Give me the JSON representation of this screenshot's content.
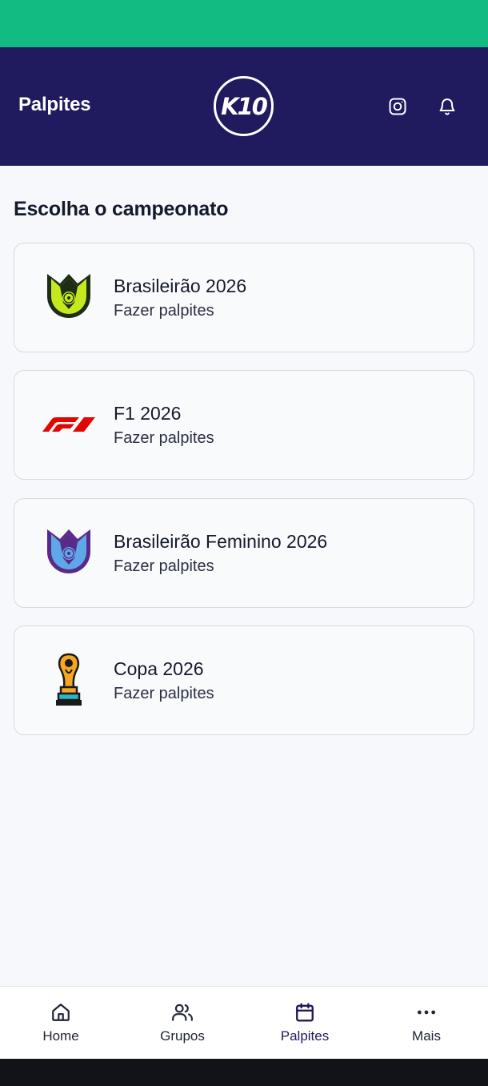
{
  "header": {
    "title": "Palpites",
    "logo_text": "K10"
  },
  "main": {
    "section_title": "Escolha o campeonato",
    "championships": [
      {
        "name": "Brasileirão 2026",
        "action": "Fazer palpites",
        "icon": "brasileirao-emblem-icon"
      },
      {
        "name": "F1 2026",
        "action": "Fazer palpites",
        "icon": "f1-logo-icon"
      },
      {
        "name": "Brasileirão Feminino 2026",
        "action": "Fazer palpites",
        "icon": "brasileirao-feminino-emblem-icon"
      },
      {
        "name": "Copa 2026",
        "action": "Fazer palpites",
        "icon": "world-cup-trophy-icon"
      }
    ]
  },
  "bottom_nav": [
    {
      "label": "Home",
      "icon": "home-icon",
      "active": false
    },
    {
      "label": "Grupos",
      "icon": "users-icon",
      "active": false
    },
    {
      "label": "Palpites",
      "icon": "calendar-icon",
      "active": true
    },
    {
      "label": "Mais",
      "icon": "more-dots-icon",
      "active": false
    }
  ],
  "colors": {
    "status_bar": "#12bb82",
    "header_bg": "#201a5e",
    "page_bg": "#f7f8fb",
    "active_nav": "#201a5e"
  }
}
